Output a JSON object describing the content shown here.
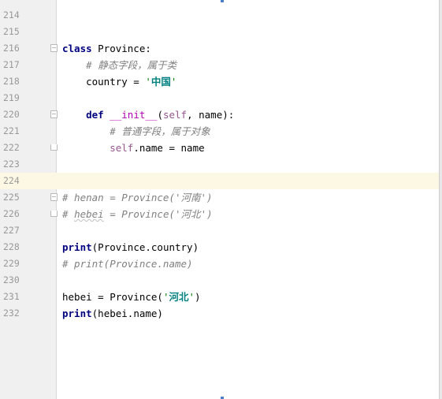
{
  "editor": {
    "language": "python",
    "current_line": "224",
    "lines": [
      {
        "num": "214",
        "parts": []
      },
      {
        "num": "215",
        "parts": []
      },
      {
        "num": "216",
        "fold": "open",
        "parts": [
          {
            "t": "class ",
            "c": "kw"
          },
          {
            "t": "Province:",
            "c": ""
          }
        ]
      },
      {
        "num": "217",
        "parts": [
          {
            "t": "    # ",
            "c": "cm"
          },
          {
            "t": "静态字段，属于类",
            "c": "cm cjk"
          }
        ]
      },
      {
        "num": "218",
        "parts": [
          {
            "t": "    country = ",
            "c": ""
          },
          {
            "t": "'",
            "c": "strq"
          },
          {
            "t": "中国",
            "c": "str cjk"
          },
          {
            "t": "'",
            "c": "strq"
          }
        ]
      },
      {
        "num": "219",
        "parts": []
      },
      {
        "num": "220",
        "fold": "open",
        "parts": [
          {
            "t": "    ",
            "c": ""
          },
          {
            "t": "def ",
            "c": "kw"
          },
          {
            "t": "__init__",
            "c": "magic"
          },
          {
            "t": "(",
            "c": ""
          },
          {
            "t": "self",
            "c": "selfc"
          },
          {
            "t": ", name):",
            "c": ""
          }
        ]
      },
      {
        "num": "221",
        "parts": [
          {
            "t": "        # ",
            "c": "cm"
          },
          {
            "t": "普通字段，属于对象",
            "c": "cm cjk"
          }
        ]
      },
      {
        "num": "222",
        "fold": "end",
        "parts": [
          {
            "t": "        ",
            "c": ""
          },
          {
            "t": "self",
            "c": "selfc"
          },
          {
            "t": ".name = name",
            "c": ""
          }
        ]
      },
      {
        "num": "223",
        "parts": []
      },
      {
        "num": "224",
        "parts": []
      },
      {
        "num": "225",
        "fold": "open",
        "parts": [
          {
            "t": "# henan = Province('",
            "c": "cm"
          },
          {
            "t": "河南",
            "c": "cm cjk"
          },
          {
            "t": "')",
            "c": "cm"
          }
        ]
      },
      {
        "num": "226",
        "fold": "end",
        "parts": [
          {
            "t": "# ",
            "c": "cm"
          },
          {
            "t": "hebei",
            "c": "cm squig"
          },
          {
            "t": " = Province('",
            "c": "cm"
          },
          {
            "t": "河北",
            "c": "cm cjk"
          },
          {
            "t": "')",
            "c": "cm"
          }
        ]
      },
      {
        "num": "227",
        "parts": []
      },
      {
        "num": "228",
        "parts": [
          {
            "t": "print",
            "c": "kw"
          },
          {
            "t": "(Province.country)",
            "c": ""
          }
        ]
      },
      {
        "num": "229",
        "parts": [
          {
            "t": "# print(Province.name)",
            "c": "cm"
          }
        ]
      },
      {
        "num": "230",
        "parts": []
      },
      {
        "num": "231",
        "parts": [
          {
            "t": "hebei = Province(",
            "c": ""
          },
          {
            "t": "'",
            "c": "strq"
          },
          {
            "t": "河北",
            "c": "str cjk"
          },
          {
            "t": "'",
            "c": "strq"
          },
          {
            "t": ")",
            "c": ""
          }
        ]
      },
      {
        "num": "232",
        "parts": [
          {
            "t": "print",
            "c": "kw"
          },
          {
            "t": "(hebei.name)",
            "c": ""
          }
        ]
      }
    ]
  }
}
